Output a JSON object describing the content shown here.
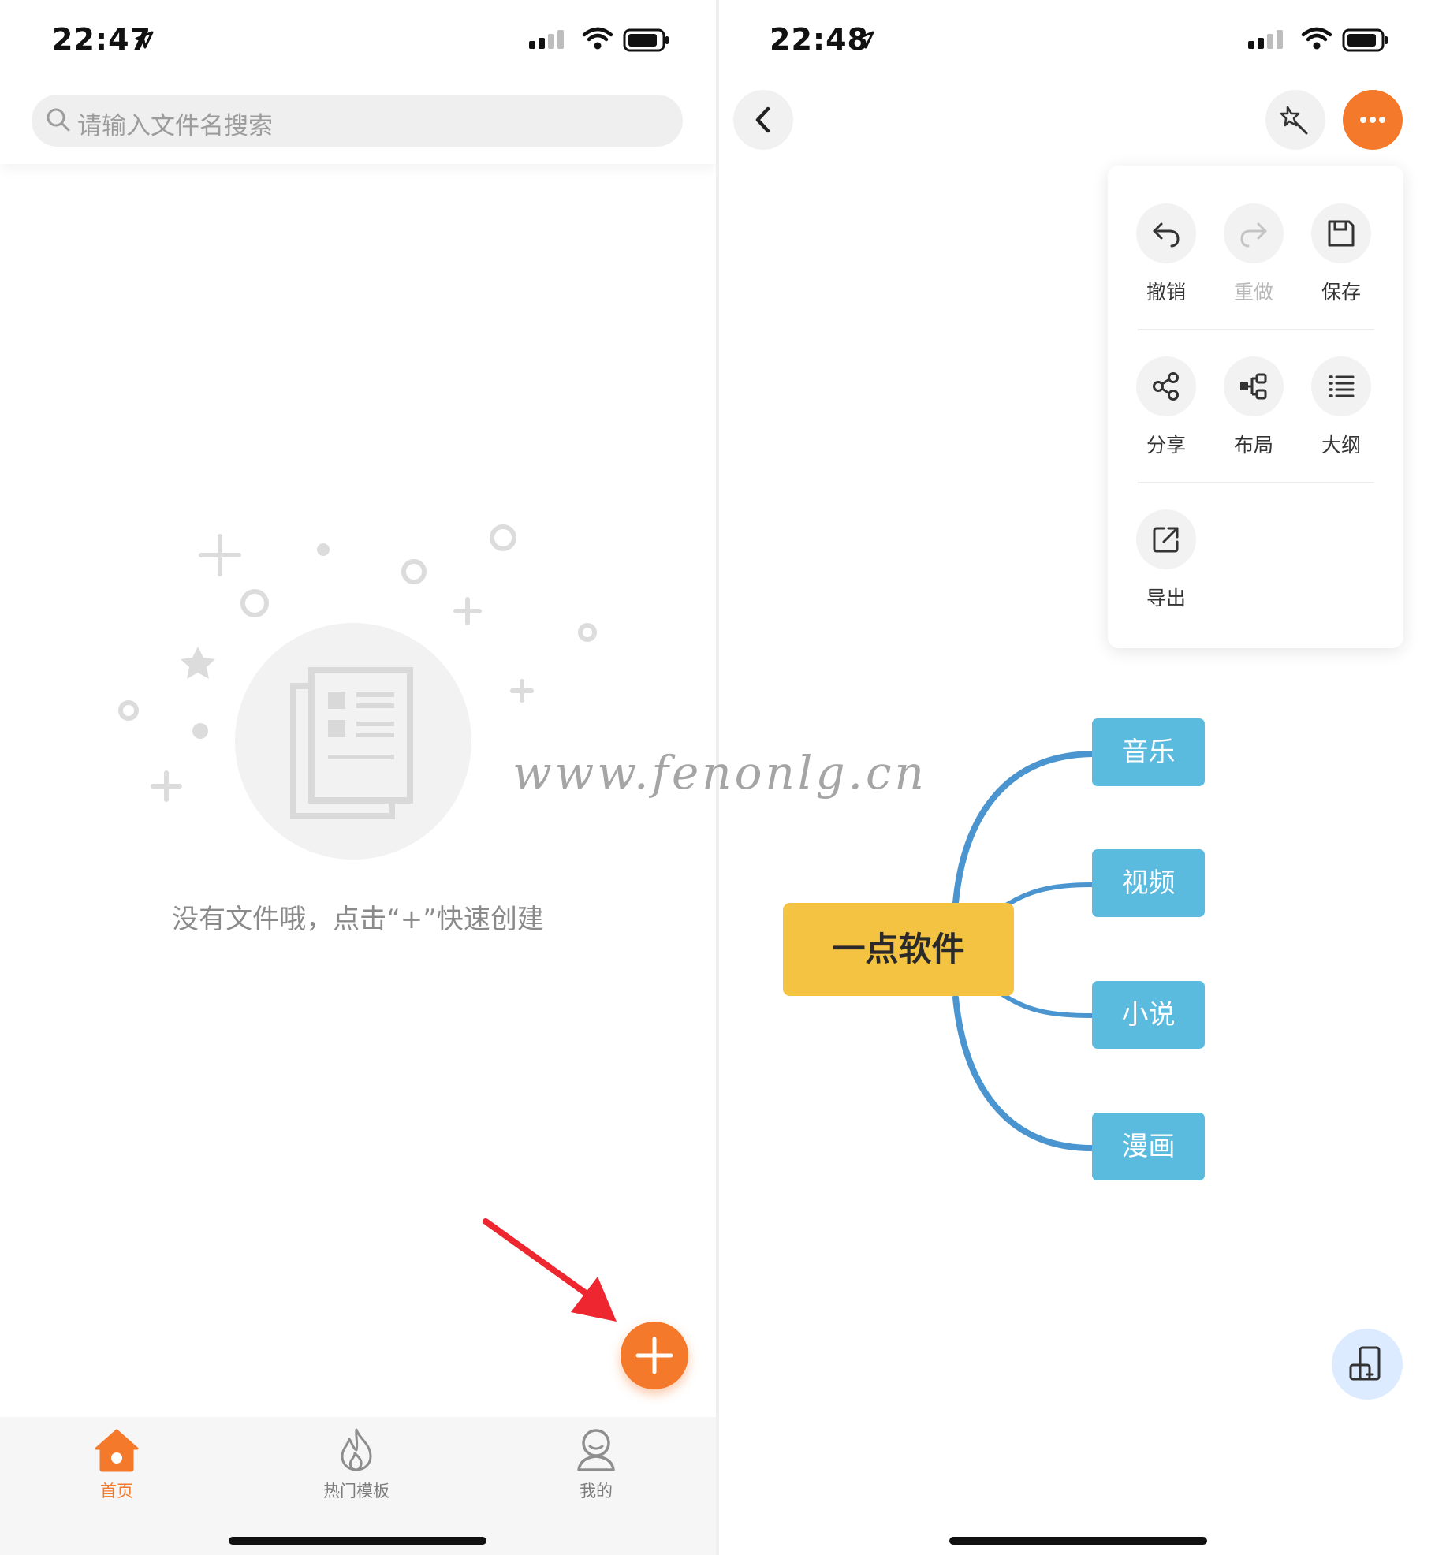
{
  "left_screen": {
    "status_time": "22:47",
    "search": {
      "placeholder": "请输入文件名搜索"
    },
    "empty_message": "没有文件哦，点击“+”快速创建",
    "tabs": [
      {
        "label": "首页",
        "icon": "home-icon",
        "active": true
      },
      {
        "label": "热门模板",
        "icon": "flame-icon",
        "active": false
      },
      {
        "label": "我的",
        "icon": "user-icon",
        "active": false
      }
    ]
  },
  "right_screen": {
    "status_time": "22:48",
    "menu": {
      "items": [
        {
          "label": "撤销",
          "icon": "undo-icon",
          "enabled": true
        },
        {
          "label": "重做",
          "icon": "redo-icon",
          "enabled": false
        },
        {
          "label": "保存",
          "icon": "save-icon",
          "enabled": true
        },
        {
          "label": "分享",
          "icon": "share-icon",
          "enabled": true
        },
        {
          "label": "布局",
          "icon": "layout-icon",
          "enabled": true
        },
        {
          "label": "大纲",
          "icon": "outline-icon",
          "enabled": true
        },
        {
          "label": "导出",
          "icon": "export-icon",
          "enabled": true
        }
      ]
    },
    "mindmap": {
      "root": "一点软件",
      "children": [
        "音乐",
        "视频",
        "小说",
        "漫画"
      ]
    }
  },
  "watermark": "www.fenonlg.cn",
  "colors": {
    "accent_orange": "#f5792a",
    "root_node": "#f5c342",
    "child_node": "#5bbbdf",
    "branch_line": "#4a95cf",
    "arrow_red": "#ee2630"
  }
}
